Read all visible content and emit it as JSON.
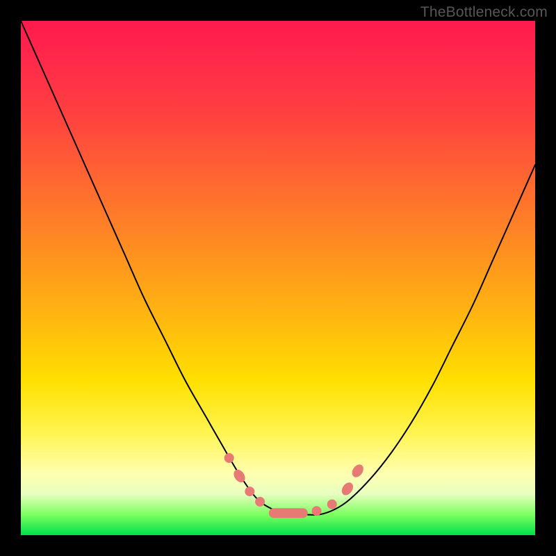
{
  "source_watermark": "TheBottleneck.com",
  "colors": {
    "frame": "#000000",
    "gradient_stops": [
      "#ff1a4d",
      "#ff4040",
      "#ff9020",
      "#ffe000",
      "#ffffb0",
      "#00e04a"
    ],
    "curve": "#000000",
    "markers": "#e77a74"
  },
  "chart_data": {
    "type": "line",
    "title": "",
    "xlabel": "",
    "ylabel": "",
    "xlim": [
      0,
      100
    ],
    "ylim": [
      0,
      100
    ],
    "grid": false,
    "legend": false,
    "note": "Axes are hidden; values are estimated from relative pixel positions (0 = left/bottom, 100 = right/top).",
    "series": [
      {
        "name": "curve",
        "x": [
          0,
          4,
          8,
          12,
          16,
          20,
          24,
          28,
          32,
          36,
          40,
          43,
          46,
          49,
          52,
          55,
          58,
          61,
          64,
          68,
          72,
          76,
          80,
          84,
          88,
          92,
          96,
          100
        ],
        "y": [
          100,
          91,
          82,
          73,
          64,
          55,
          46,
          38,
          30,
          23,
          16,
          11,
          7,
          5,
          4,
          4,
          4,
          5,
          7,
          11,
          16,
          22,
          29,
          37,
          45,
          54,
          63,
          72
        ]
      }
    ],
    "markers": [
      {
        "shape": "circle",
        "x": 40.5,
        "y": 15.0
      },
      {
        "shape": "oval",
        "x": 42.5,
        "y": 11.5
      },
      {
        "shape": "circle",
        "x": 44.5,
        "y": 8.5
      },
      {
        "shape": "circle",
        "x": 46.5,
        "y": 6.5
      },
      {
        "shape": "pill",
        "x": 52.0,
        "y": 4.3
      },
      {
        "shape": "circle",
        "x": 57.5,
        "y": 4.7
      },
      {
        "shape": "circle",
        "x": 60.5,
        "y": 6.0
      },
      {
        "shape": "oval",
        "x": 63.5,
        "y": 9.0
      },
      {
        "shape": "oval",
        "x": 65.5,
        "y": 12.5
      }
    ]
  }
}
